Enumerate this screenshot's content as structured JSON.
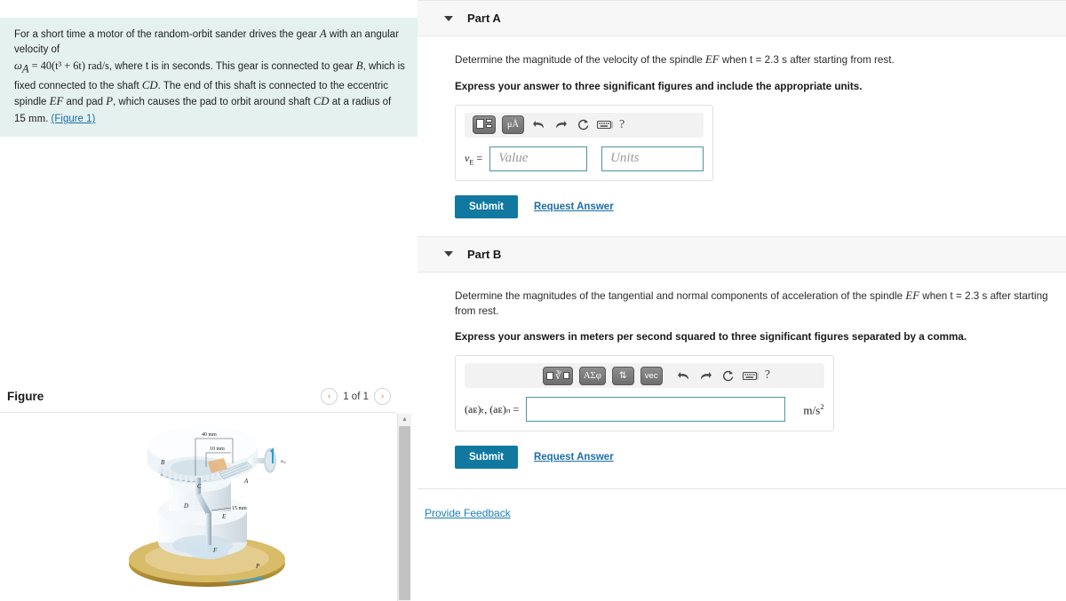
{
  "problem": {
    "line1_a": "For a short time a motor of the random-orbit sander drives the gear ",
    "gear_a": "A",
    "line1_b": " with an angular velocity of",
    "omega_expr": "ω",
    "omega_sub": "A",
    "omega_eq": " = 40(t³ + 6t) rad/s",
    "line2": ", where t is in seconds. This gear is connected to gear ",
    "gear_b": "B",
    "line2_b": ", which is fixed",
    "line3": "connected to the shaft ",
    "shaft_cd": "CD",
    "line3_b": ". The end of this shaft is connected to the eccentric spindle ",
    "spindle_ef": "EF",
    "line3_c": " and",
    "line4": "pad ",
    "pad_p": "P",
    "line4_b": ", which causes the pad to orbit around shaft ",
    "shaft_cd2": "CD",
    "line4_c": " at a radius of 15 ",
    "mm": "mm",
    "line4_d": ". ",
    "figure_link": "(Figure 1)"
  },
  "figure": {
    "title": "Figure",
    "pager_label": "1 of 1",
    "prev_icon": "‹",
    "next_icon": "›",
    "labels": {
      "dim_40": "40 mm",
      "dim_10": "10 mm",
      "dim_15": "15 mm",
      "pt_a": "A",
      "pt_b": "B",
      "pt_c": "C",
      "pt_d": "D",
      "pt_e": "E",
      "pt_f": "F",
      "pt_p": "P",
      "omega_a": "ωₐ"
    }
  },
  "parts": [
    {
      "title": "Part A",
      "caret_icon": "chevron-down-icon",
      "prompt_a": "Determine the magnitude of the velocity of the spindle ",
      "prompt_ef": "EF",
      "prompt_b": " when t = 2.3 s after starting from rest.",
      "instruction": "Express your answer to three significant figures and include the appropriate units.",
      "toolbar": [
        {
          "name": "template-icon",
          "label": ""
        },
        {
          "name": "units-icon",
          "label": "μÅ"
        },
        {
          "name": "undo-icon",
          "label": "↶"
        },
        {
          "name": "redo-icon",
          "label": "↷"
        },
        {
          "name": "reset-icon",
          "label": "↻"
        },
        {
          "name": "keyboard-icon",
          "label": "⌨"
        },
        {
          "name": "help-icon",
          "label": "?"
        }
      ],
      "var_label_main": "v",
      "var_label_sub": "E",
      "var_label_eq": " =",
      "value_placeholder": "Value",
      "units_placeholder": "Units",
      "value": "",
      "units": "",
      "submit_label": "Submit",
      "request_label": "Request Answer"
    },
    {
      "title": "Part B",
      "caret_icon": "chevron-down-icon",
      "prompt_a": "Determine the magnitudes of the tangential and normal components of acceleration of the spindle ",
      "prompt_ef": "EF",
      "prompt_b": " when t = 2.3 s after starting from rest.",
      "instruction": "Express your answers in meters per second squared to three significant figures separated by a comma.",
      "toolbar": [
        {
          "name": "template-radical-icon",
          "label": ""
        },
        {
          "name": "greek-letters-icon",
          "label": "ΑΣφ"
        },
        {
          "name": "subscript-superscript-icon",
          "label": "⇅"
        },
        {
          "name": "vector-icon",
          "label": "vec"
        },
        {
          "name": "undo-icon",
          "label": "↶"
        },
        {
          "name": "redo-icon",
          "label": "↷"
        },
        {
          "name": "reset-icon",
          "label": "↻"
        },
        {
          "name": "keyboard-icon",
          "label": "⌨"
        },
        {
          "name": "help-icon",
          "label": "?"
        }
      ],
      "var_label_full": "(aᴇ)ₜ, (aᴇ)ₙ =",
      "value": "",
      "units_suffix": "m/s",
      "units_exp": "2",
      "submit_label": "Submit",
      "request_label": "Request Answer"
    }
  ],
  "feedback": {
    "label": "Provide Feedback"
  },
  "colors": {
    "problem_bg": "#e4f1ef",
    "part_header_bg": "#f7f7f7",
    "submit_bg": "#1179a0",
    "link": "#1b6ea8",
    "input_border": "#4e93a8",
    "pad_gold": "#c9a441"
  }
}
